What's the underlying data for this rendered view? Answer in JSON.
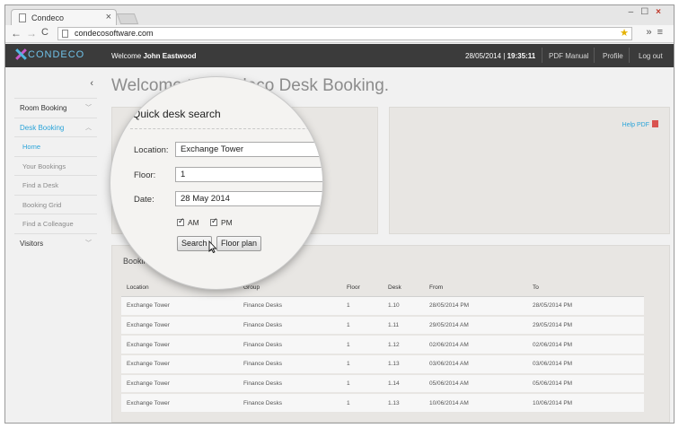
{
  "browser": {
    "tab_title": "Condeco",
    "tab_close": "×",
    "url": "condecosoftware.com",
    "nav_back": "←",
    "nav_forward": "→",
    "nav_reload": "C",
    "window_controls": [
      "–",
      "☐",
      "×"
    ],
    "toolbar_right": [
      "»",
      "≡"
    ]
  },
  "header": {
    "logo_text": "CONDECO",
    "welcome_prefix": "Welcome",
    "user_name": "John Eastwood",
    "date": "28/05/2014",
    "time": "19:35:11",
    "links": [
      "PDF Manual",
      "Profile",
      "Log out"
    ]
  },
  "sidebar": {
    "collapse_glyph": "‹",
    "items": [
      {
        "label": "Room Booking",
        "type": "section"
      },
      {
        "label": "Desk Booking",
        "type": "section",
        "active": true
      },
      {
        "label": "Home",
        "type": "sub",
        "active": true
      },
      {
        "label": "Your Bookings",
        "type": "sub"
      },
      {
        "label": "Find a Desk",
        "type": "sub"
      },
      {
        "label": "Booking Grid",
        "type": "sub"
      },
      {
        "label": "Find a Colleague",
        "type": "sub"
      },
      {
        "label": "Visitors",
        "type": "section"
      }
    ]
  },
  "main": {
    "title": "Welcome to Condeco Desk Booking.",
    "help_pdf": "Help PDF",
    "bookings_title": "Bookings",
    "columns": [
      "Location",
      "Group",
      "Floor",
      "Desk",
      "From",
      "To"
    ],
    "rows": [
      [
        "Exchange Tower",
        "Finance Desks",
        "1",
        "1.10",
        "28/05/2014 PM",
        "28/05/2014 PM"
      ],
      [
        "Exchange Tower",
        "Finance Desks",
        "1",
        "1.11",
        "29/05/2014 AM",
        "29/05/2014 PM"
      ],
      [
        "Exchange Tower",
        "Finance Desks",
        "1",
        "1.12",
        "02/06/2014 AM",
        "02/06/2014 PM"
      ],
      [
        "Exchange Tower",
        "Finance Desks",
        "1",
        "1.13",
        "03/06/2014 AM",
        "03/06/2014 PM"
      ],
      [
        "Exchange Tower",
        "Finance Desks",
        "1",
        "1.14",
        "05/06/2014 AM",
        "05/06/2014 PM"
      ],
      [
        "Exchange Tower",
        "Finance Desks",
        "1",
        "1.13",
        "10/06/2014 AM",
        "10/06/2014 PM"
      ]
    ]
  },
  "quick_search": {
    "title": "Quick desk search",
    "location_label": "Location:",
    "location_value": "Exchange Tower",
    "floor_label": "Floor:",
    "floor_value": "1",
    "date_label": "Date:",
    "date_value": "28 May 2014",
    "am_label": "AM",
    "pm_label": "PM",
    "search_button": "Search",
    "floorplan_button": "Floor plan"
  },
  "colors": {
    "accent": "#2ba4d9",
    "header_bg": "#3b3b3b",
    "logo_blue": "#6fc1e8",
    "logo_magenta": "#c75ac9"
  }
}
